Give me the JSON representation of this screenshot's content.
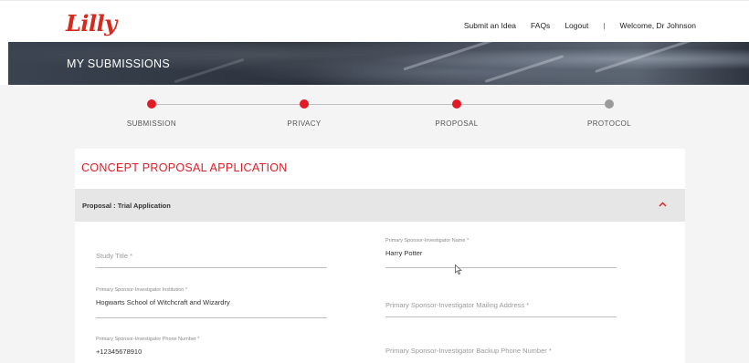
{
  "header": {
    "logo_text": "Lilly",
    "nav": [
      "Submit an Idea",
      "FAQs",
      "Logout"
    ],
    "separator": "|",
    "welcome": "Welcome, Dr Johnson"
  },
  "banner": {
    "title": "MY SUBMISSIONS"
  },
  "stepper": {
    "steps": [
      {
        "label": "SUBMISSION",
        "status": "active"
      },
      {
        "label": "PRIVACY",
        "status": "active"
      },
      {
        "label": "PROPOSAL",
        "status": "active"
      },
      {
        "label": "PROTOCOL",
        "status": "pending"
      }
    ],
    "active_color": "#e21a23",
    "pending_color": "#9a9a9a"
  },
  "form": {
    "title": "CONCEPT PROPOSAL APPLICATION",
    "section_title": "Proposal : Trial Application",
    "fields": {
      "study_title": {
        "placeholder": "Study Title *"
      },
      "investigator_name": {
        "label": "Primary Sponsor-Investigator Name *",
        "value": "Harry Potter"
      },
      "institution": {
        "label": "Primary Sponsor-Investigator Institution *",
        "value": "Hogwarts School of Witchcraft and Wizardry"
      },
      "mailing_address": {
        "placeholder": "Primary Sponsor-Investigator Mailing Address *"
      },
      "phone": {
        "label": "Primary Sponsor-Investigator Phone Number *",
        "value": "+12345678910"
      },
      "backup_phone": {
        "placeholder": "Primary Sponsor-Investigator Backup Phone Number *"
      }
    }
  },
  "colors": {
    "brand": "#d52b1e",
    "accent": "#e21a23"
  }
}
